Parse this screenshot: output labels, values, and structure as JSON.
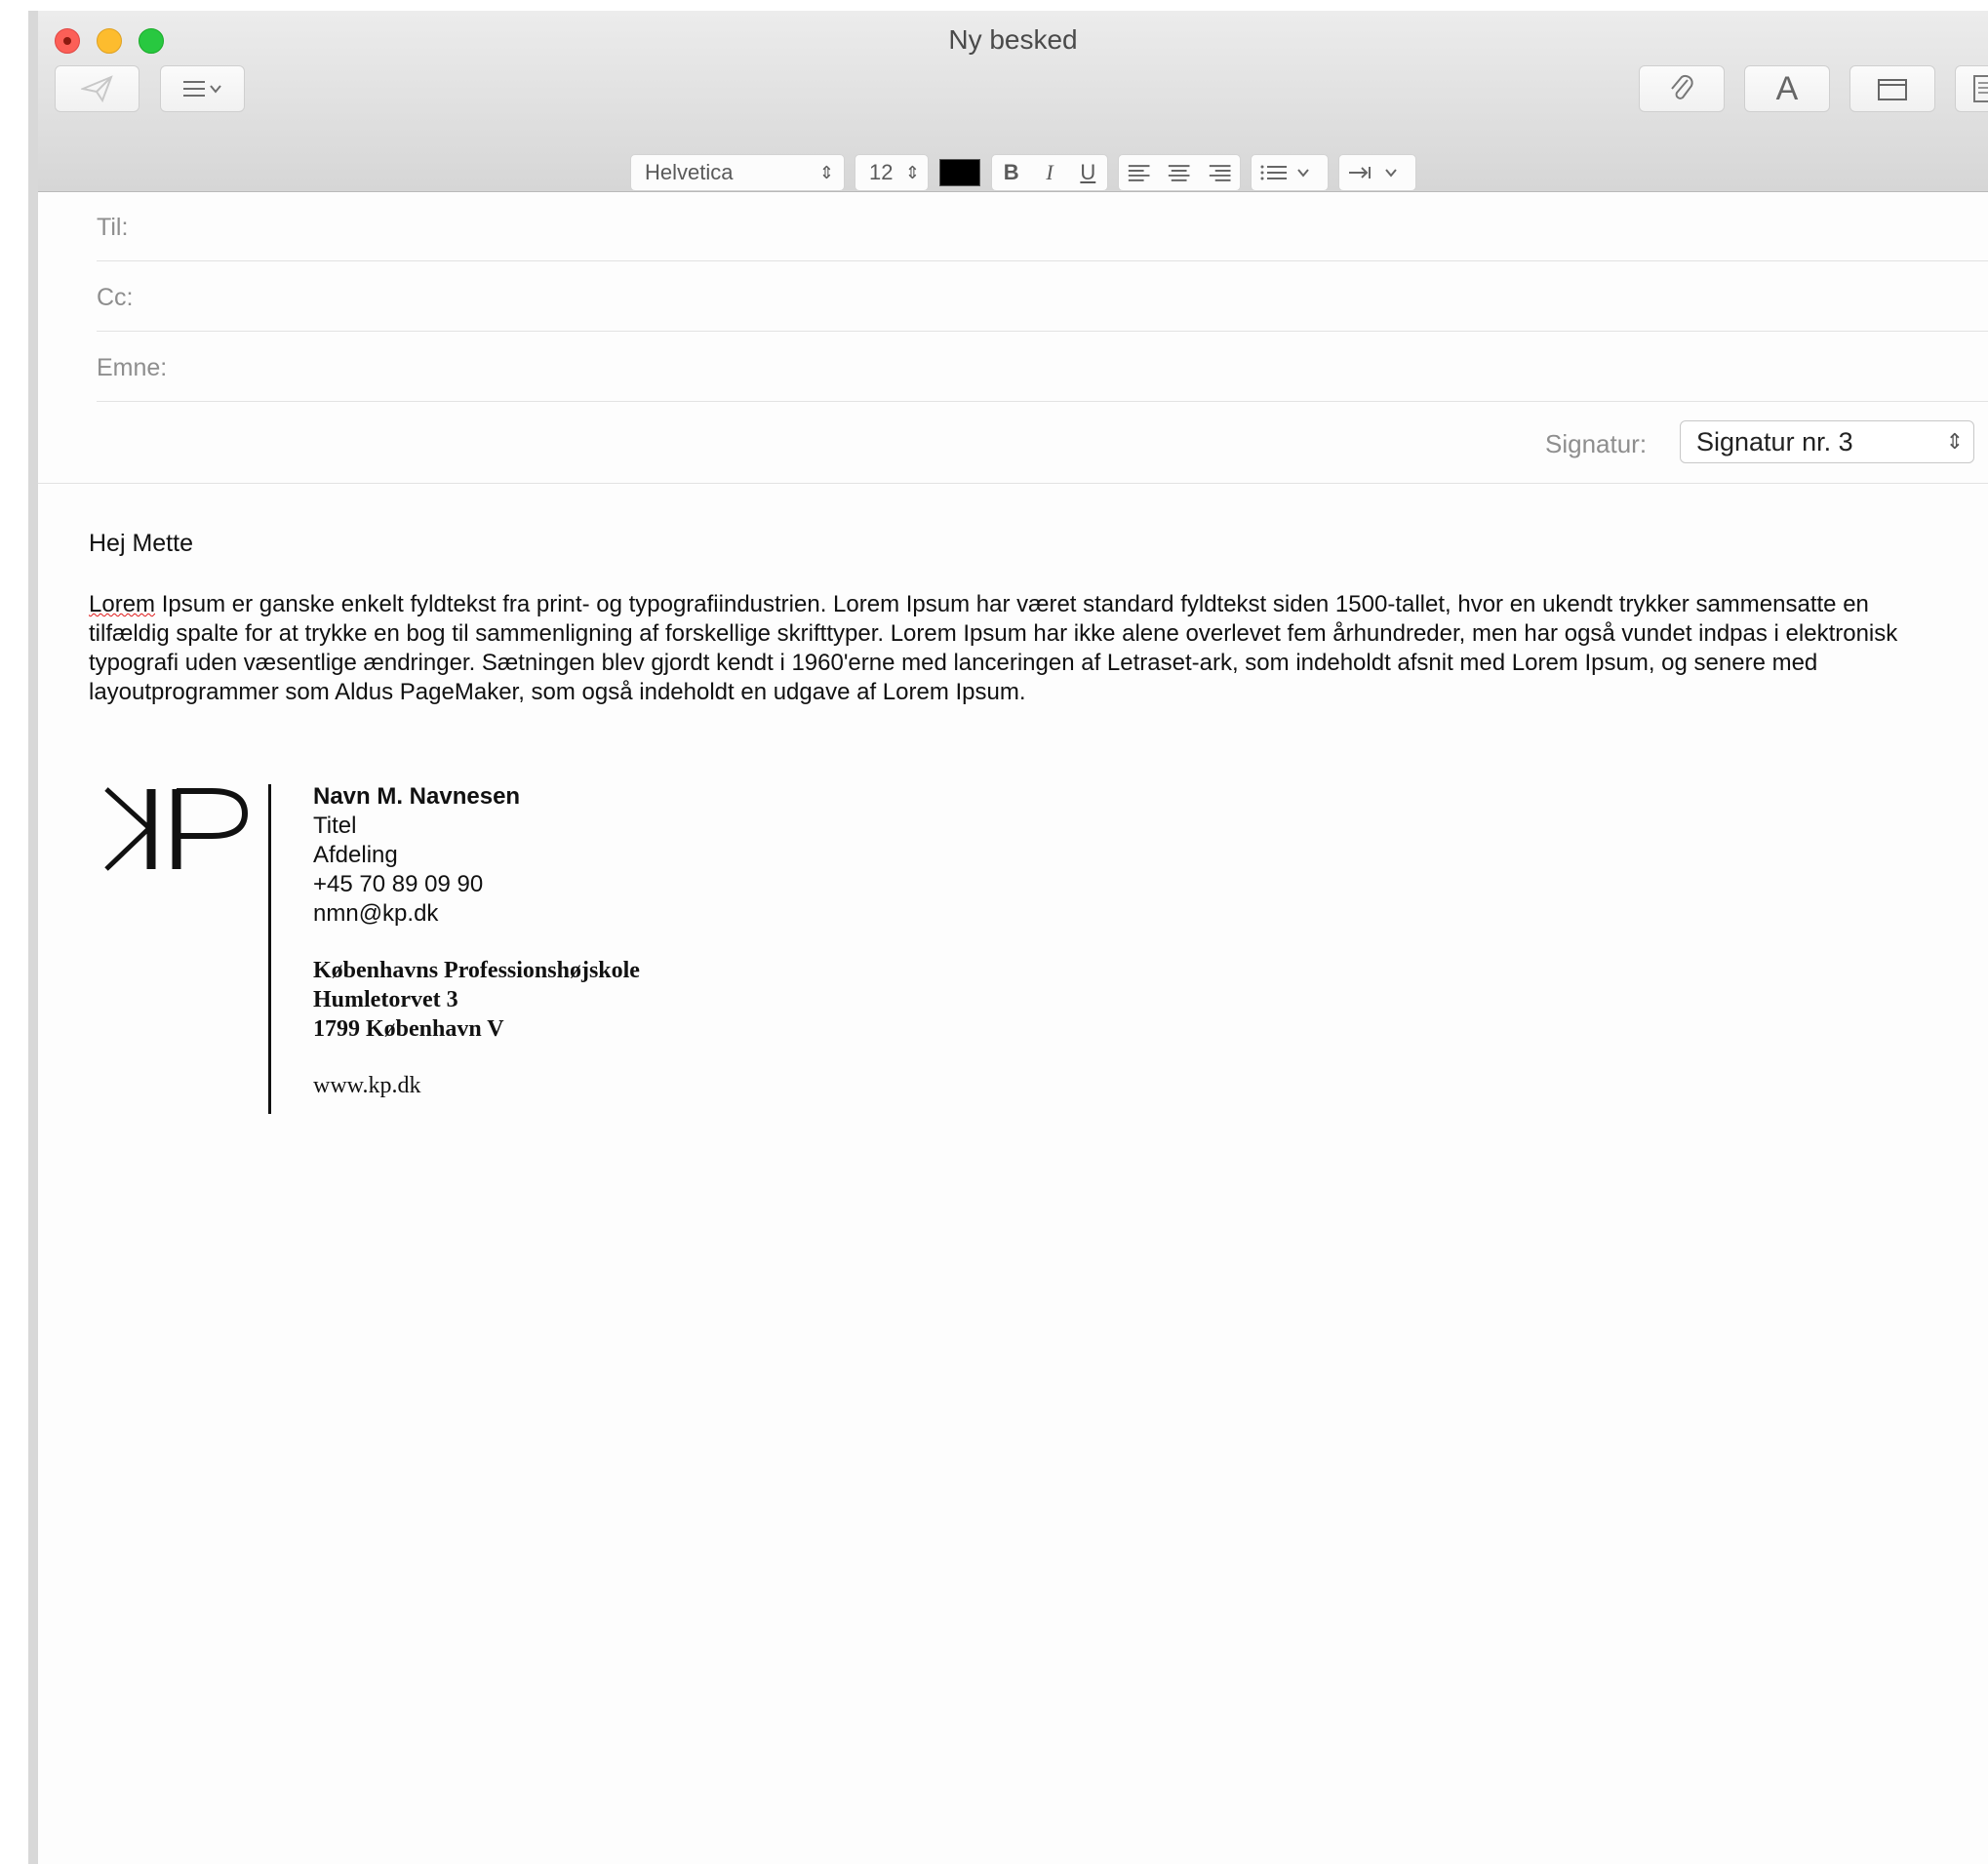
{
  "window": {
    "title": "Ny besked"
  },
  "toolbar": {
    "send_icon": "send-icon",
    "header_fields_icon": "list-icon",
    "attach_icon": "paperclip-icon",
    "fonts_label": "A",
    "browser_icon": "window-icon",
    "stationery_icon": "document-icon"
  },
  "format_bar": {
    "font": "Helvetica",
    "size": "12",
    "color": "#000000",
    "bold": "B",
    "italic": "I",
    "underline": "U"
  },
  "fields": {
    "to_label": "Til:",
    "cc_label": "Cc:",
    "subject_label": "Emne:",
    "signature_label": "Signatur:",
    "signature_value": "Signatur nr. 3"
  },
  "message": {
    "greeting": "Hej Mette",
    "first_word": "Lorem",
    "body": " Ipsum er ganske enkelt fyldtekst fra print- og typografiindustrien. Lorem Ipsum har været standard fyldtekst siden 1500-tallet, hvor en ukendt trykker sammensatte en tilfældig spalte for at trykke en bog til sammenligning af forskellige skrifttyper. Lorem Ipsum har ikke alene overlevet fem århundreder, men har også vundet indpas i elektronisk typografi uden væsentlige ændringer. Sætningen blev gjordt kendt i 1960'erne med lanceringen af Letraset-ark, som indeholdt afsnit med Lorem Ipsum, og senere med layoutprogrammer som Aldus PageMaker, som også indeholdt en udgave af Lorem Ipsum."
  },
  "signature": {
    "logo_text": "KP",
    "name": "Navn M. Navnesen",
    "title": "Titel",
    "department": "Afdeling",
    "phone": "+45 70 89 09 90",
    "email": "nmn@kp.dk",
    "org": "Københavns Professionshøjskole",
    "street": "Humletorvet 3",
    "city": "1799 København V",
    "web": "www.kp.dk"
  }
}
